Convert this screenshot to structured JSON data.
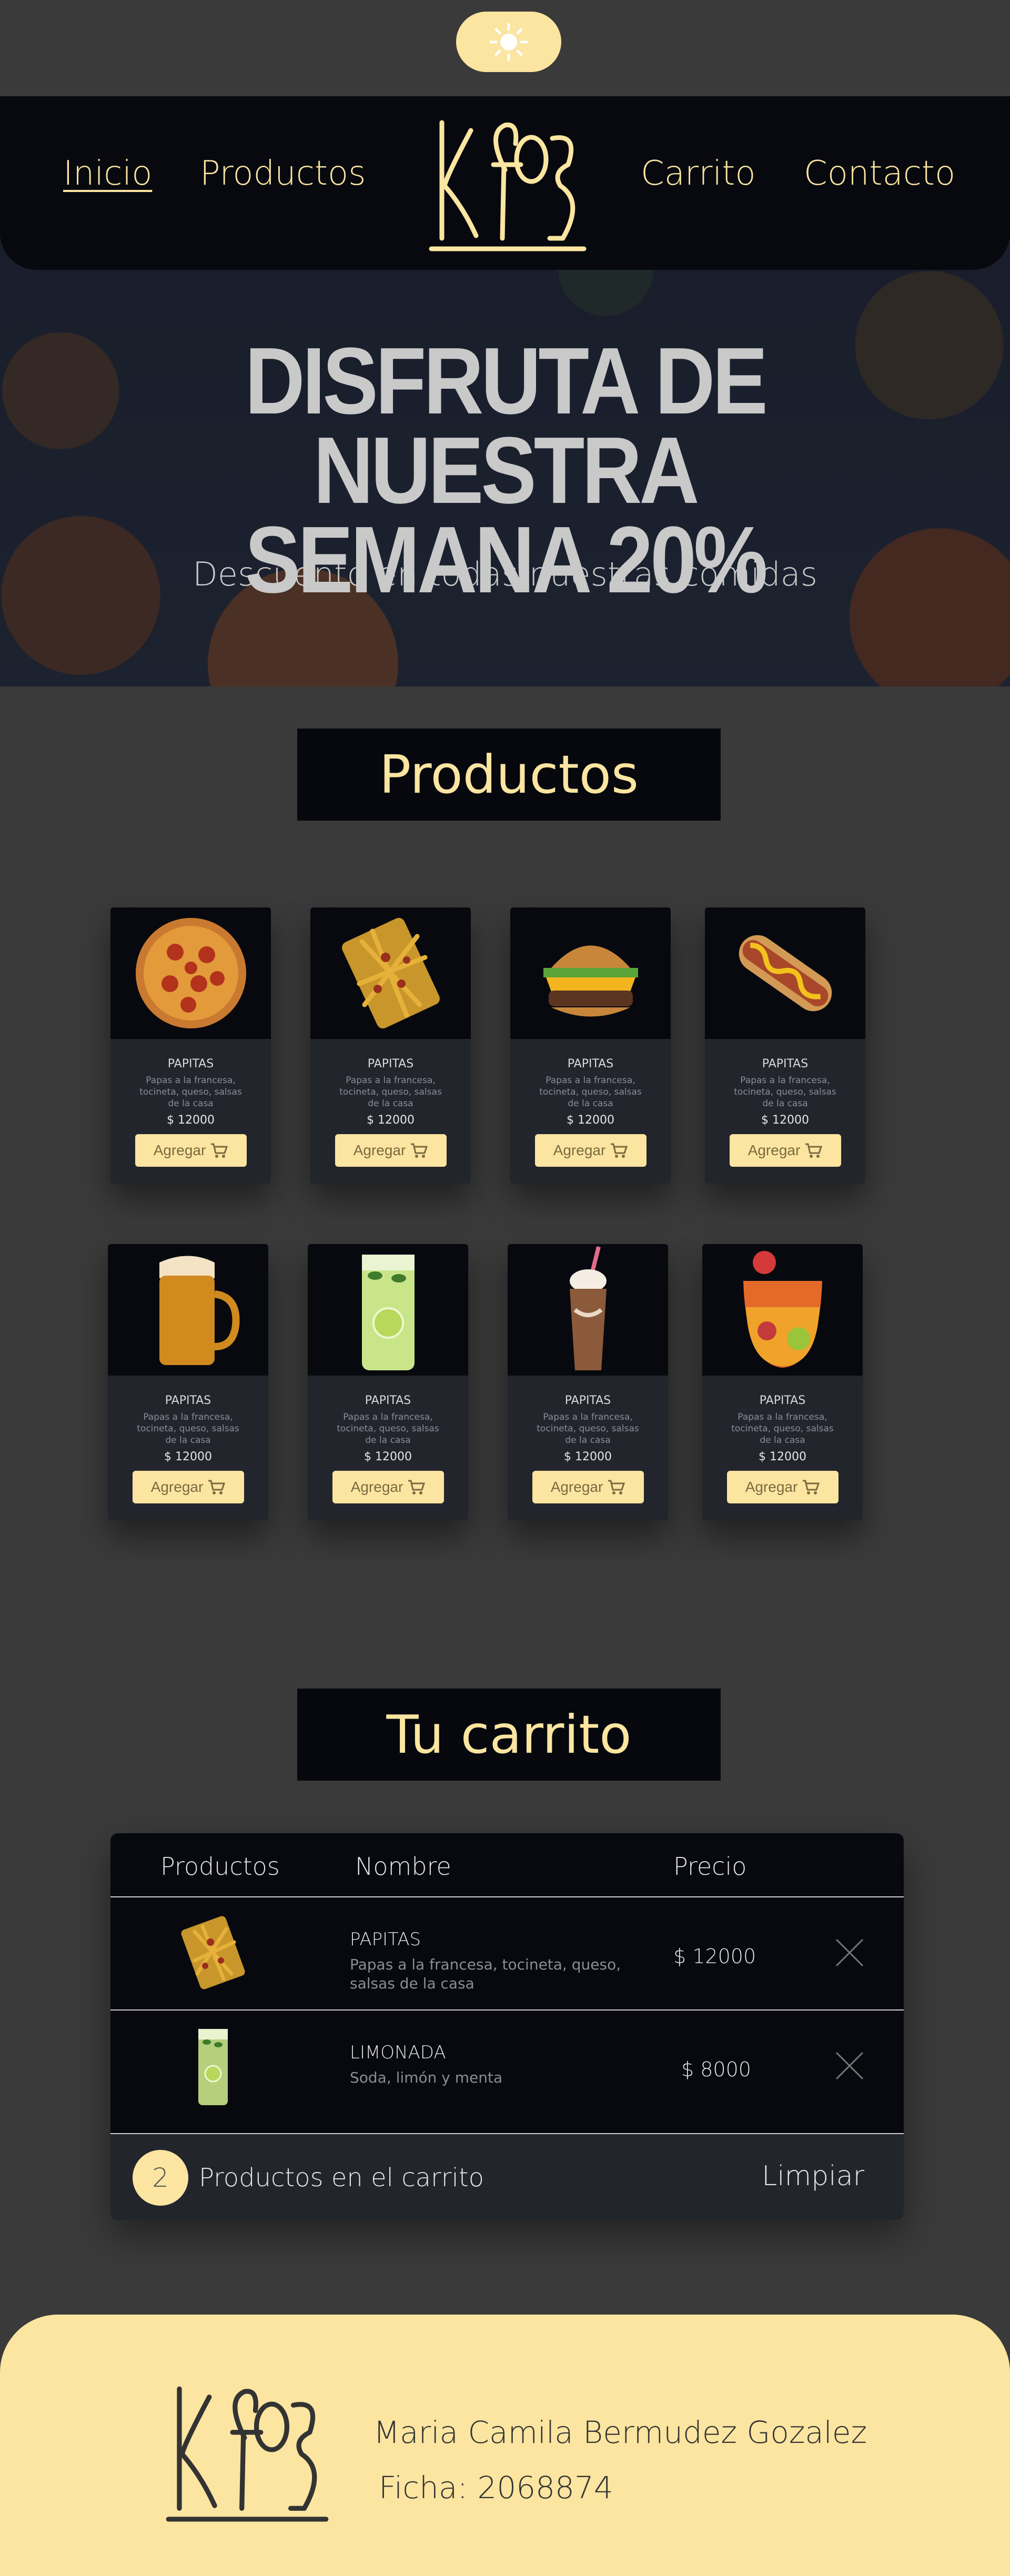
{
  "nav": {
    "links": [
      "Inicio",
      "Productos",
      "Carrito",
      "Contacto"
    ],
    "logo_text": "KFOOD"
  },
  "theme_toggle_icon": "sun-icon",
  "hero": {
    "title_line1": "DISFRUTA DE NUESTRA",
    "title_line2": "SEMANA 20%",
    "subtitle": "Descuento en todas nuestras comidas"
  },
  "products_section": {
    "title": "Productos",
    "items": [
      {
        "image": "pizza",
        "name": "PAPITAS",
        "description": "Papas a la francesa, tocineta, queso, salsas de la casa",
        "price": "$ 12000",
        "button": "Agregar"
      },
      {
        "image": "fries",
        "name": "PAPITAS",
        "description": "Papas a la francesa, tocineta, queso, salsas de la casa",
        "price": "$ 12000",
        "button": "Agregar"
      },
      {
        "image": "burger",
        "name": "PAPITAS",
        "description": "Papas a la francesa, tocineta, queso, salsas de la casa",
        "price": "$ 12000",
        "button": "Agregar"
      },
      {
        "image": "hotdog",
        "name": "PAPITAS",
        "description": "Papas a la francesa, tocineta, queso, salsas de la casa",
        "price": "$ 12000",
        "button": "Agregar"
      },
      {
        "image": "beer",
        "name": "PAPITAS",
        "description": "Papas a la francesa, tocineta, queso, salsas de la casa",
        "price": "$ 12000",
        "button": "Agregar"
      },
      {
        "image": "lemonade",
        "name": "PAPITAS",
        "description": "Papas a la francesa, tocineta, queso, salsas de la casa",
        "price": "$ 12000",
        "button": "Agregar"
      },
      {
        "image": "milkshake",
        "name": "PAPITAS",
        "description": "Papas a la francesa, tocineta, queso, salsas de la casa",
        "price": "$ 12000",
        "button": "Agregar"
      },
      {
        "image": "fruit-drink",
        "name": "PAPITAS",
        "description": "Papas a la francesa, tocineta, queso, salsas de la casa",
        "price": "$ 12000",
        "button": "Agregar"
      }
    ]
  },
  "cart_section": {
    "title": "Tu carrito",
    "columns": [
      "Productos",
      "Nombre",
      "Precio"
    ],
    "rows": [
      {
        "image": "fries",
        "name": "PAPITAS",
        "description": "Papas a la francesa, tocineta, queso, salsas de la casa",
        "price": "$ 12000"
      },
      {
        "image": "lemonade",
        "name": "LIMONADA",
        "description": "Soda, limón y menta",
        "price": "$ 8000"
      }
    ],
    "count": "2",
    "count_label": "Productos en el carrito",
    "clear_button": "Limpiar"
  },
  "footer": {
    "logo_text": "KFOOD",
    "name": "Maria Camila Bermudez Gozalez",
    "ficha": "Ficha: 2068874"
  },
  "colors": {
    "accent": "#fbe5a0",
    "page_bg": "#3a3a3a",
    "dark": "#07090f",
    "card": "#23252d"
  }
}
